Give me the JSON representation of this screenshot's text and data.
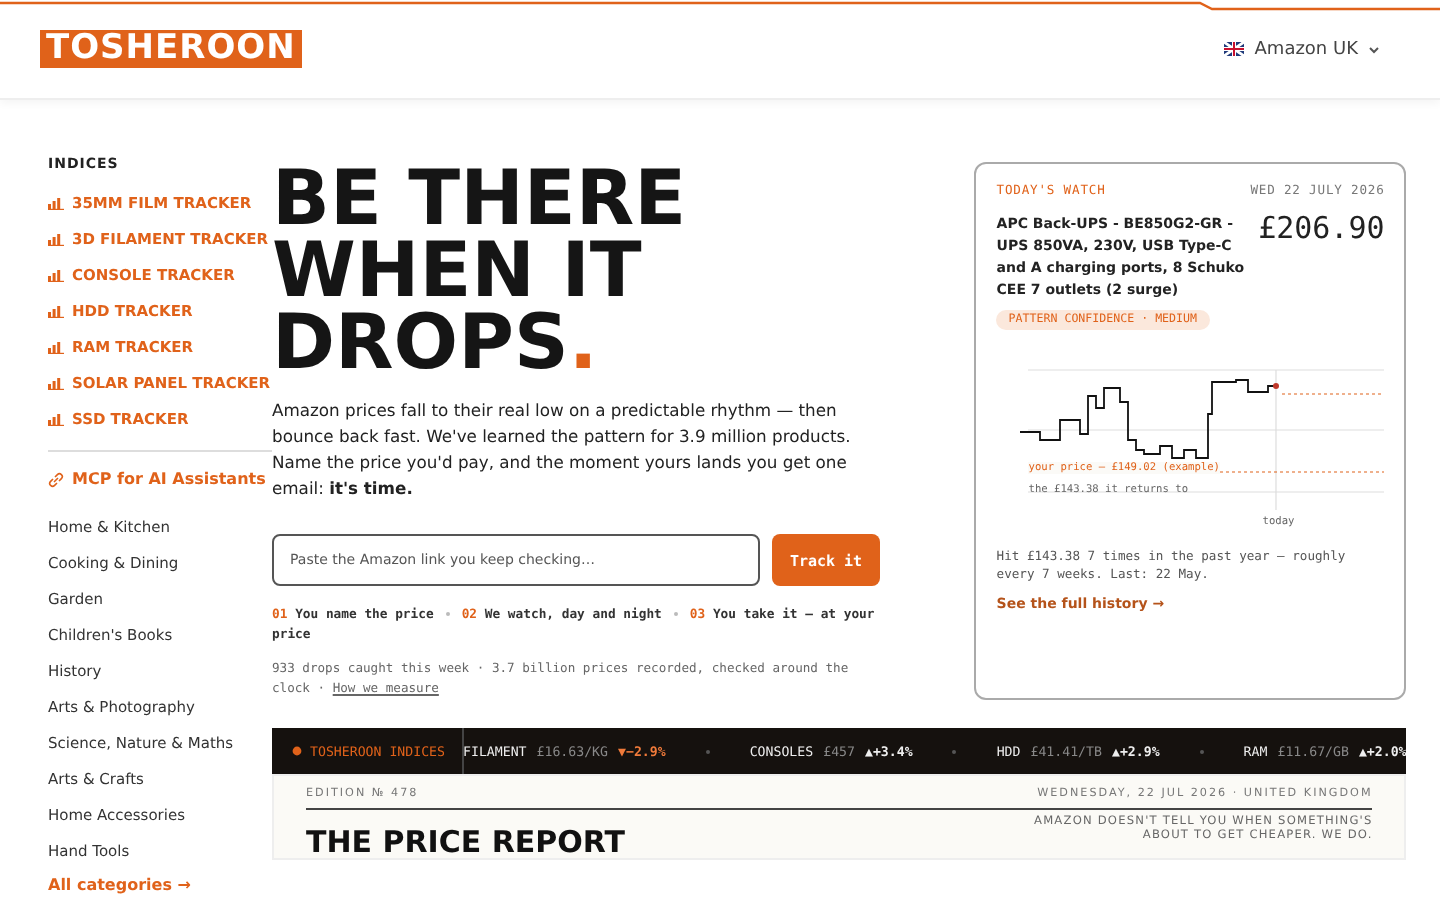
{
  "header": {
    "logo": "TOSHEROON",
    "store": "Amazon UK"
  },
  "sidebar": {
    "heading": "INDICES",
    "indices": [
      "35MM FILM TRACKER",
      "3D FILAMENT TRACKER",
      "CONSOLE TRACKER",
      "HDD TRACKER",
      "RAM TRACKER",
      "SOLAR PANEL TRACKER",
      "SSD TRACKER"
    ],
    "mcp_link": "MCP for AI Assistants",
    "categories": [
      "Home & Kitchen",
      "Cooking & Dining",
      "Garden",
      "Children's Books",
      "History",
      "Arts & Photography",
      "Science, Nature & Maths",
      "Arts & Crafts",
      "Home Accessories",
      "Hand Tools"
    ],
    "all_link": "All categories →"
  },
  "hero": {
    "lines": [
      "BE THERE",
      "WHEN IT",
      "DROPS"
    ],
    "accent": ".",
    "body": "Amazon prices fall to their real low on a predictable rhythm — then bounce back fast. We've learned the pattern for 3.9 million products. Name the price you'd pay, and the moment yours lands you get one email: **it's time.**",
    "input": {
      "placeholder": "Paste the Amazon link you keep checking…"
    },
    "button": "Track it",
    "steps": [
      {
        "num": "01",
        "text": "You name the price"
      },
      {
        "num": "02",
        "text": "We watch, day and night"
      },
      {
        "num": "03",
        "text": "You take it — at your price"
      }
    ],
    "stats": "933 drops caught this week · 3.7 billion prices recorded, checked around the clock ·",
    "measure_link": "How we measure"
  },
  "watch": {
    "label": "TODAY'S WATCH",
    "date": "WED 22 JULY 2026",
    "product": "APC Back-UPS - BE850G2-GR - UPS 850VA, 230V, USB Type-C and A charging ports, 8 Schuko CEE 7 outlets (2 surge)",
    "price": "£206.90",
    "badge": "PATTERN CONFIDENCE · MEDIUM",
    "chart_labels": {
      "target": "your price — £149.02 (example)",
      "floor": "the £143.38 it returns to",
      "today": "today"
    },
    "summary": "Hit £143.38 7 times in the past year — roughly every 7 weeks. Last: 22 May.",
    "link": "See the full history →"
  },
  "ticker": {
    "label": "TOSHEROON INDICES",
    "items": [
      {
        "name": "FILAMENT",
        "price": "£16.63/KG",
        "change": "▼−2.9%",
        "falling": true
      },
      {
        "name": "CONSOLES",
        "price": "£457",
        "change": "▲+3.4%",
        "falling": false
      },
      {
        "name": "HDD",
        "price": "£41.41/TB",
        "change": "▲+2.9%",
        "falling": false
      },
      {
        "name": "RAM",
        "price": "£11.67/GB",
        "change": "▲+2.0%",
        "falling": false
      }
    ]
  },
  "report": {
    "edition": "EDITION № 478",
    "dateline": "WEDNESDAY, 22 JUL 2026 · UNITED KINGDOM",
    "title": "THE PRICE REPORT",
    "tagline": "AMAZON DOESN'T TELL YOU WHEN SOMETHING'S ABOUT TO GET CHEAPER. WE DO."
  }
}
